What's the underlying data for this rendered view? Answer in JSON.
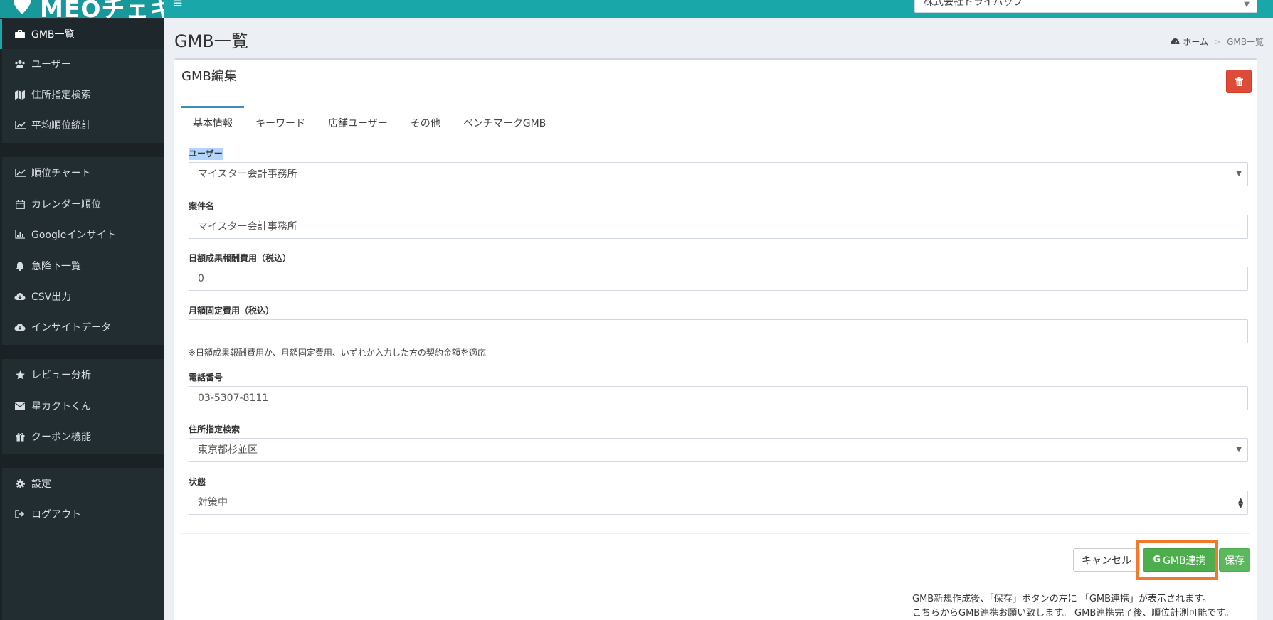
{
  "header": {
    "logo_text": "MEOチェキ",
    "menu_icon": "hamburger-icon",
    "company_select_value": "株式会社ドライバップ"
  },
  "sidebar": {
    "items": [
      {
        "label": "GMB一覧",
        "icon": "briefcase-icon",
        "active": true
      },
      {
        "label": "ユーザー",
        "icon": "users-icon"
      },
      {
        "label": "住所指定検索",
        "icon": "map-icon"
      },
      {
        "label": "平均順位統計",
        "icon": "line-chart-icon"
      },
      {
        "label": "順位チャート",
        "icon": "line-chart-icon"
      },
      {
        "label": "カレンダー順位",
        "icon": "calendar-icon"
      },
      {
        "label": "Googleインサイト",
        "icon": "bar-chart-icon"
      },
      {
        "label": "急降下一覧",
        "icon": "bell-icon"
      },
      {
        "label": "CSV出力",
        "icon": "cloud-download-icon"
      },
      {
        "label": "インサイトデータ",
        "icon": "cloud-download-icon"
      },
      {
        "label": "レビュー分析",
        "icon": "star-icon"
      },
      {
        "label": "星カクトくん",
        "icon": "envelope-icon"
      },
      {
        "label": "クーポン機能",
        "icon": "gift-icon"
      },
      {
        "label": "設定",
        "icon": "gear-icon"
      },
      {
        "label": "ログアウト",
        "icon": "sign-out-icon"
      }
    ]
  },
  "page": {
    "title": "GMB一覧",
    "breadcrumb": {
      "home": "ホーム",
      "current": "GMB一覧"
    }
  },
  "box": {
    "title": "GMB編集",
    "delete_icon": "trash-icon"
  },
  "tabs": [
    {
      "label": "基本情報",
      "active": true
    },
    {
      "label": "キーワード"
    },
    {
      "label": "店舗ユーザー"
    },
    {
      "label": "その他"
    },
    {
      "label": "ベンチマークGMB"
    }
  ],
  "form": {
    "user": {
      "label": "ユーザー",
      "value": "マイスター会計事務所"
    },
    "case_name": {
      "label": "案件名",
      "value": "マイスター会計事務所"
    },
    "daily_fee": {
      "label": "日額成果報酬費用（税込）",
      "value": "0"
    },
    "monthly_fee": {
      "label": "月額固定費用（税込）",
      "value": "",
      "help": "※日額成果報酬費用か、月額固定費用、いずれか入力した方の契約金額を適応"
    },
    "phone": {
      "label": "電話番号",
      "value": "03-5307-8111"
    },
    "address_search": {
      "label": "住所指定検索",
      "value": "東京都杉並区"
    },
    "status": {
      "label": "状態",
      "value": "対策中"
    }
  },
  "actions": {
    "cancel": "キャンセル",
    "gmb_link": "GMB連携",
    "gmb_link_icon": "google-icon",
    "save": "保存"
  },
  "note": {
    "line1": "GMB新規作成後、「保存」ボタンの左に 「GMB連携」が表示されます。",
    "line2": "こちらからGMB連携お願い致します。 GMB連携完了後、順位計測可能です。"
  },
  "colors": {
    "header": "#1aa7a9",
    "sidebar": "#222d32",
    "save_green": "#5cb85c",
    "delete_red": "#dd4b39",
    "highlight_orange": "#ee7a2e"
  }
}
